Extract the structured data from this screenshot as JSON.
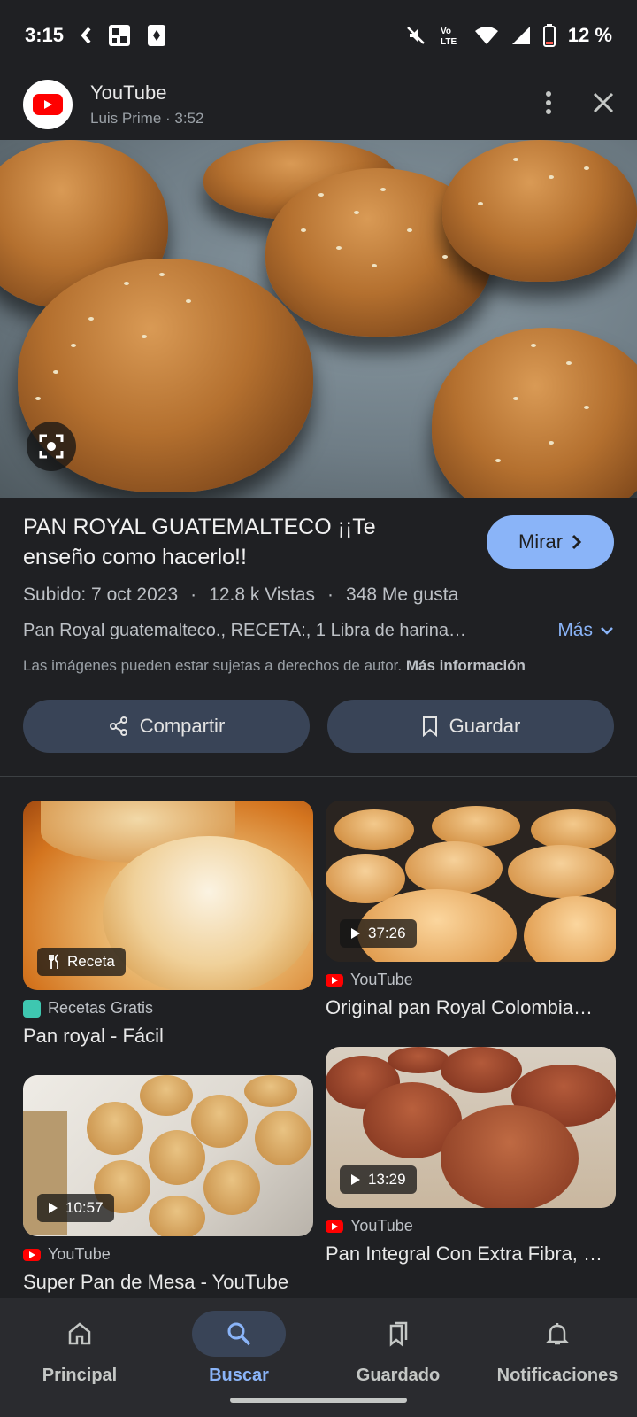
{
  "status_bar": {
    "time": "3:15",
    "battery": "12 %",
    "icons": [
      "back-chevron-icon",
      "grid-icon",
      "cards-icon",
      "mute-icon",
      "volte-icon",
      "wifi-icon",
      "signal-icon",
      "battery-icon"
    ],
    "volte_text": "Vo LTE"
  },
  "header": {
    "source": "YouTube",
    "subtitle": "Luis Prime · 3:52"
  },
  "result": {
    "title": "PAN ROYAL GUATEMALTECO ¡¡Te enseño como hacerlo!!",
    "watch_label": "Mirar",
    "uploaded": "Subido: 7 oct 2023",
    "views": "12.8 k Vistas",
    "likes": "348 Me gusta",
    "separator": "·",
    "description": "Pan Royal guatemalteco., RECETA:, 1 Libra de harina…",
    "more_label": "Más",
    "copyright": "Las imágenes pueden estar sujetas a derechos de autor.",
    "copyright_link": "Más información",
    "share_label": "Compartir",
    "save_label": "Guardar"
  },
  "related": [
    {
      "badge": "Receta",
      "source": "Recetas Gratis",
      "title": "Pan royal - Fácil"
    },
    {
      "badge": "37:26",
      "source": "YouTube",
      "title": "Original pan Royal Colombia…"
    },
    {
      "badge": "10:57",
      "source": "YouTube",
      "title": "Super Pan de Mesa - YouTube"
    },
    {
      "badge": "13:29",
      "source": "YouTube",
      "title": "Pan Integral Con Extra Fibra, …"
    }
  ],
  "bottom_nav": [
    {
      "label": "Principal",
      "icon": "home-icon"
    },
    {
      "label": "Buscar",
      "icon": "search-icon",
      "active": true
    },
    {
      "label": "Guardado",
      "icon": "bookmarks-icon"
    },
    {
      "label": "Notificaciones",
      "icon": "bell-icon"
    }
  ],
  "colors": {
    "accent": "#8ab4f8",
    "background": "#1f2023",
    "pill": "#394457",
    "youtube_red": "#ff0000"
  }
}
